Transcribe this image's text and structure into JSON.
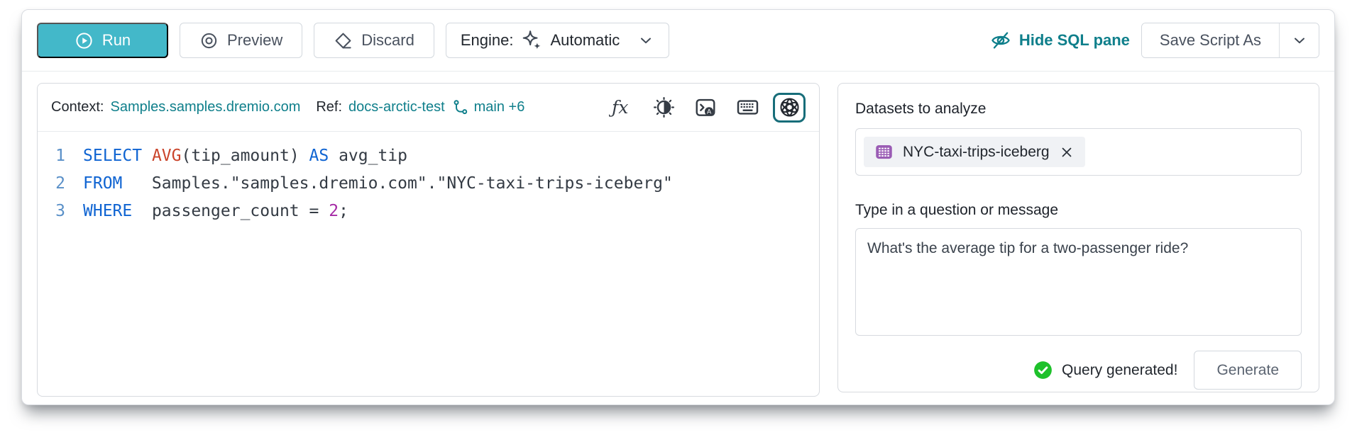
{
  "toolbar": {
    "run_label": "Run",
    "preview_label": "Preview",
    "discard_label": "Discard",
    "engine_label": "Engine:",
    "engine_value": "Automatic",
    "hide_sql_label": "Hide SQL pane",
    "save_script_label": "Save Script As"
  },
  "context_bar": {
    "context_label": "Context:",
    "context_value": "Samples.samples.dremio.com",
    "ref_label": "Ref:",
    "ref_value": "docs-arctic-test",
    "branch_label": "main +6"
  },
  "editor": {
    "lines": [
      {
        "num": "1",
        "tokens": [
          [
            "kw",
            "SELECT"
          ],
          [
            "pl",
            " "
          ],
          [
            "fn",
            "AVG"
          ],
          [
            "pl",
            "(tip_amount) "
          ],
          [
            "kw",
            "AS"
          ],
          [
            "pl",
            " avg_tip"
          ]
        ]
      },
      {
        "num": "2",
        "tokens": [
          [
            "kw",
            "FROM"
          ],
          [
            "pl",
            "   Samples.\"samples.dremio.com\".\"NYC-taxi-trips-iceberg\""
          ]
        ]
      },
      {
        "num": "3",
        "tokens": [
          [
            "kw",
            "WHERE"
          ],
          [
            "pl",
            "  passenger_count = "
          ],
          [
            "num",
            "2"
          ],
          [
            "pl",
            ";"
          ]
        ]
      }
    ]
  },
  "assistant": {
    "datasets_label": "Datasets to analyze",
    "dataset_chip_label": "NYC-taxi-trips-iceberg",
    "question_label": "Type in a question or message",
    "question_value": "What's the average tip for a two-passenger ride?",
    "status_label": "Query generated!",
    "generate_label": "Generate"
  },
  "icons": [
    "play-circle-icon",
    "preview-icon",
    "discard-eraser-icon",
    "sparkle-icon",
    "chevron-down-icon",
    "eye-off-icon",
    "git-branch-icon",
    "fx-icon",
    "contrast-icon",
    "terminal-autocomplete-icon",
    "keyboard-icon",
    "rosette-ai-icon",
    "dataset-table-icon",
    "close-icon",
    "check-circle-icon"
  ],
  "colors": {
    "accent_teal": "#43b8c9",
    "link_teal": "#0f7f8b",
    "selected_icon_border": "#176d79",
    "dataset_icon_purple": "#9a5cb4",
    "success_green": "#1ec12b",
    "sql_keyword": "#0f64d2",
    "sql_function": "#ca452c",
    "sql_number": "#a62ba6",
    "line_number_blue": "#5a90c8"
  }
}
